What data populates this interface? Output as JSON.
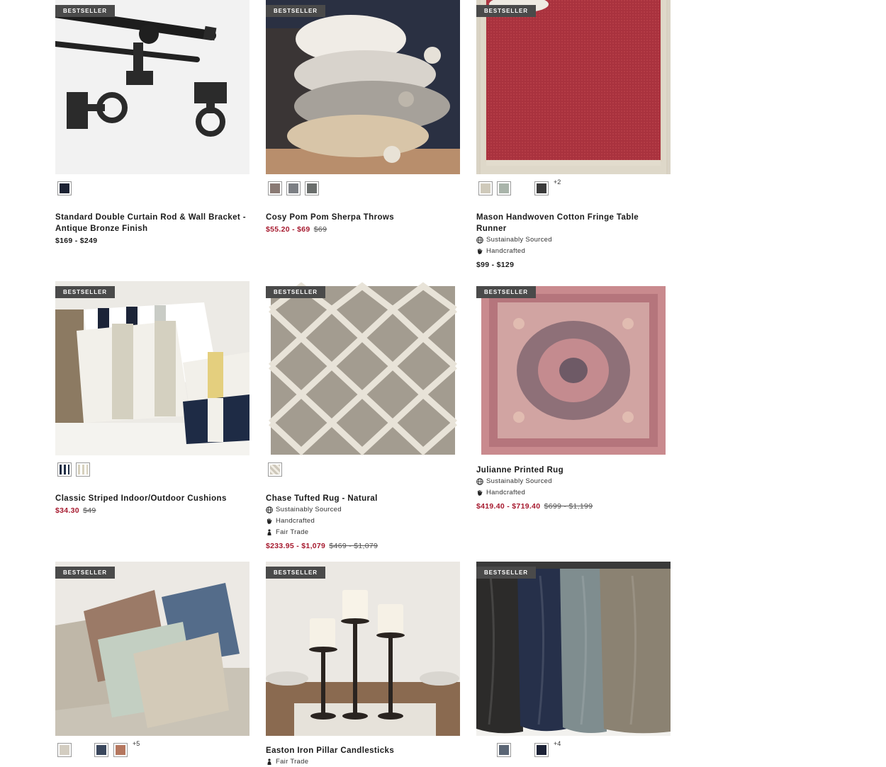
{
  "products": [
    {
      "badge": "BESTSELLER",
      "title": "Standard Double Curtain Rod & Wall Bracket - Antique Bronze Finish",
      "price": "$169 - $249",
      "swatch_colors": [
        "#1c2233"
      ]
    },
    {
      "badge": "BESTSELLER",
      "title": "Cosy Pom Pom Sherpa Throws",
      "sale_price": "$55.20 - $69",
      "original_price": "$69",
      "swatch_colors": [
        "#8a7a74",
        "#7c7f84",
        "#6a6e6c"
      ]
    },
    {
      "badge": "BESTSELLER",
      "title": "Mason Handwoven Cotton Fringe Table Runner",
      "attributes": [
        "Sustainably Sourced",
        "Handcrafted"
      ],
      "price": "$99 - $129",
      "swatch_colors": [
        "#cfcabb",
        "#a9b4aa",
        "#ffffff",
        "#3b3b3b"
      ],
      "more": "+2"
    },
    {
      "badge": "BESTSELLER",
      "title": "Classic Striped Indoor/Outdoor Cushions",
      "sale_price": "$34.30",
      "original_price": "$49",
      "swatch_colors": [
        "#1f2d45",
        "#d6d0bd"
      ]
    },
    {
      "badge": "BESTSELLER",
      "title": "Chase Tufted Rug - Natural",
      "attributes": [
        "Sustainably Sourced",
        "Handcrafted",
        "Fair Trade"
      ],
      "sale_price": "$233.95 - $1,079",
      "original_price": "$469 - $1,079",
      "swatch_colors": [
        "#cdc7ba"
      ]
    },
    {
      "badge": "BESTSELLER",
      "title": "Julianne Printed Rug",
      "attributes": [
        "Sustainably Sourced",
        "Handcrafted"
      ],
      "sale_price": "$419.40 - $719.40",
      "original_price": "$699 - $1,199",
      "swatch_colors": []
    },
    {
      "badge": "BESTSELLER",
      "title": "",
      "swatch_colors": [
        "#d3cdc1",
        "#ffffff",
        "#3a475d",
        "#b5775f"
      ],
      "more": "+5"
    },
    {
      "badge": "BESTSELLER",
      "title": "Easton Iron Pillar Candlesticks",
      "attributes": [
        "Fair Trade"
      ],
      "swatch_colors": []
    },
    {
      "badge": "BESTSELLER",
      "title": "",
      "swatch_colors": [
        "#ffffff",
        "#5b6675",
        "#ffffff",
        "#1c2237"
      ],
      "more": "+4"
    }
  ]
}
